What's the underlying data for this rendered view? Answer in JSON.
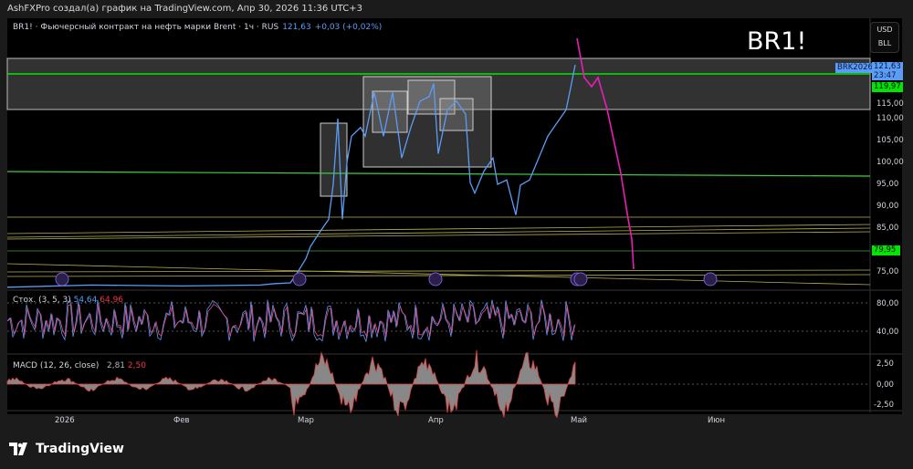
{
  "caption": "AshFXPro создал(а) график на TradingView.com, Апр 30, 2026 11:36 UTC+3",
  "legend": {
    "symbol": "BR1! · Фьючерсный контракт на нефть марки Brent · 1ч · RUS",
    "price": "121,63",
    "change": "+0,03 (+0,02%)"
  },
  "symbol_watermark": "BR1!",
  "currency": {
    "top": "USD",
    "bottom": "BLL"
  },
  "price_axis": [
    "115,00",
    "110,00",
    "105,00",
    "100,00",
    "95,00",
    "90,00",
    "85,00",
    "75,00"
  ],
  "tags": {
    "contract": "BRK2026",
    "last_price": "121,63",
    "countdown": "23:47",
    "level_high": "119,97",
    "level_low": "79,95"
  },
  "colors": {
    "price_line": "#5b9cf6",
    "projection": "#e91eb5",
    "level_green": "#00e600",
    "tag_blue": "#5b9cf6"
  },
  "stoch": {
    "label": "Стох. (3, 5, 3)",
    "k": "54,64",
    "d": "64,96",
    "axis": [
      "80,00",
      "40,00"
    ]
  },
  "macd": {
    "label": "MACD (12, 26, close)",
    "macd": "2,81",
    "signal": "2,50",
    "axis": [
      "2,50",
      "0,00",
      "-2,50"
    ]
  },
  "time_axis": [
    "2026",
    "Фев",
    "Мар",
    "Апр",
    "Май",
    "Июн"
  ],
  "footer": {
    "brand": "TradingView"
  }
}
